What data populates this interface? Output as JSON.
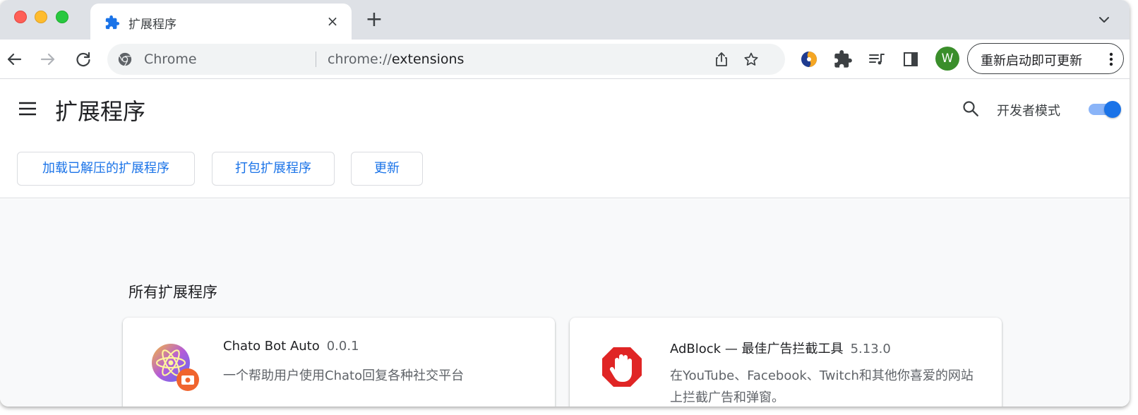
{
  "window": {
    "tab": {
      "title": "扩展程序",
      "close_glyph": "×"
    },
    "new_tab_glyph": "+"
  },
  "toolbar": {
    "omnibox": {
      "site_label": "Chrome",
      "url_scheme": "chrome://",
      "url_host": "extensions"
    },
    "avatar_letter": "W",
    "update_button_label": "重新启动即可更新"
  },
  "header": {
    "title": "扩展程序",
    "dev_mode_label": "开发者模式",
    "dev_mode_enabled": true,
    "buttons": {
      "load_unpacked": "加载已解压的扩展程序",
      "pack": "打包扩展程序",
      "update": "更新"
    }
  },
  "content": {
    "section_title": "所有扩展程序",
    "extensions": [
      {
        "name": "Chato Bot Auto",
        "version": "0.0.1",
        "description": "一个帮助用户使用Chato回复各种社交平台"
      },
      {
        "name": "AdBlock — 最佳广告拦截工具",
        "version": "5.13.0",
        "description": "在YouTube、Facebook、Twitch和其他你喜爱的网站上拦截广告和弹窗。"
      }
    ]
  },
  "colors": {
    "accent": "#1a73e8",
    "tabstrip_bg": "#dee1e6",
    "avatar_bg": "#3a8e2b",
    "adblock_red": "#e02525"
  },
  "icons": [
    "puzzle-icon",
    "close-icon",
    "plus-icon",
    "chevron-down-icon",
    "back-arrow-icon",
    "forward-arrow-icon",
    "reload-icon",
    "chrome-logo-icon",
    "share-icon",
    "star-icon",
    "sider-extension-icon",
    "extensions-puzzle-icon",
    "media-control-icon",
    "side-panel-icon",
    "kebab-menu-icon",
    "hamburger-menu-icon",
    "search-icon",
    "chato-bot-icon",
    "adblock-icon"
  ]
}
